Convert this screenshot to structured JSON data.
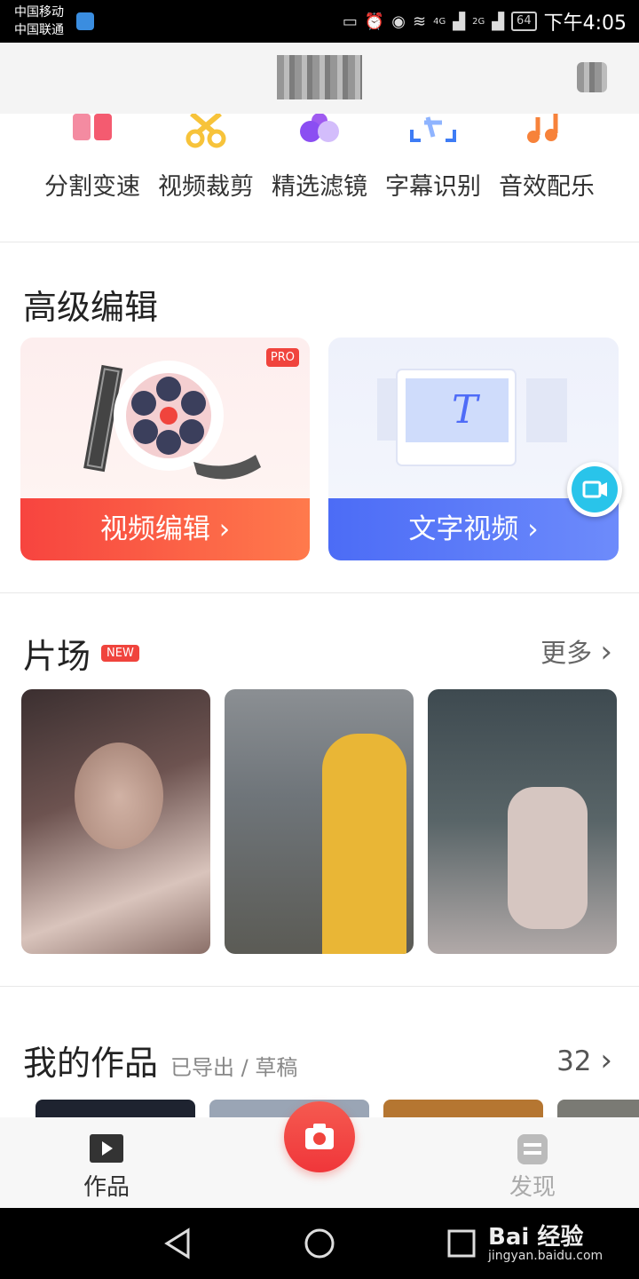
{
  "status_bar": {
    "carrier_1": "中国移动",
    "carrier_2": "中国联通",
    "network_1": "4G",
    "network_2": "2G",
    "battery": "64",
    "time": "下午4:05"
  },
  "tools": [
    {
      "label": "分割变速",
      "icon": "split-speed-icon"
    },
    {
      "label": "视频裁剪",
      "icon": "scissors-icon"
    },
    {
      "label": "精选滤镜",
      "icon": "filter-icon"
    },
    {
      "label": "字幕识别",
      "icon": "caption-scan-icon"
    },
    {
      "label": "音效配乐",
      "icon": "music-icon"
    }
  ],
  "advanced": {
    "title": "高级编辑",
    "video_edit": {
      "label": "视频编辑",
      "badge": "PRO"
    },
    "text_video": {
      "label": "文字视频"
    }
  },
  "studio": {
    "title": "片场",
    "badge": "NEW",
    "more": "更多"
  },
  "my_works": {
    "title": "我的作品",
    "subtitle": "已导出 / 草稿",
    "count": "32"
  },
  "tabbar": {
    "works": "作品",
    "discover": "发现"
  },
  "watermark": {
    "logo": "Bai 经验",
    "url": "jingyan.baidu.com"
  },
  "colors": {
    "accent_red": "#f0443d",
    "accent_blue": "#4f6cf7"
  }
}
